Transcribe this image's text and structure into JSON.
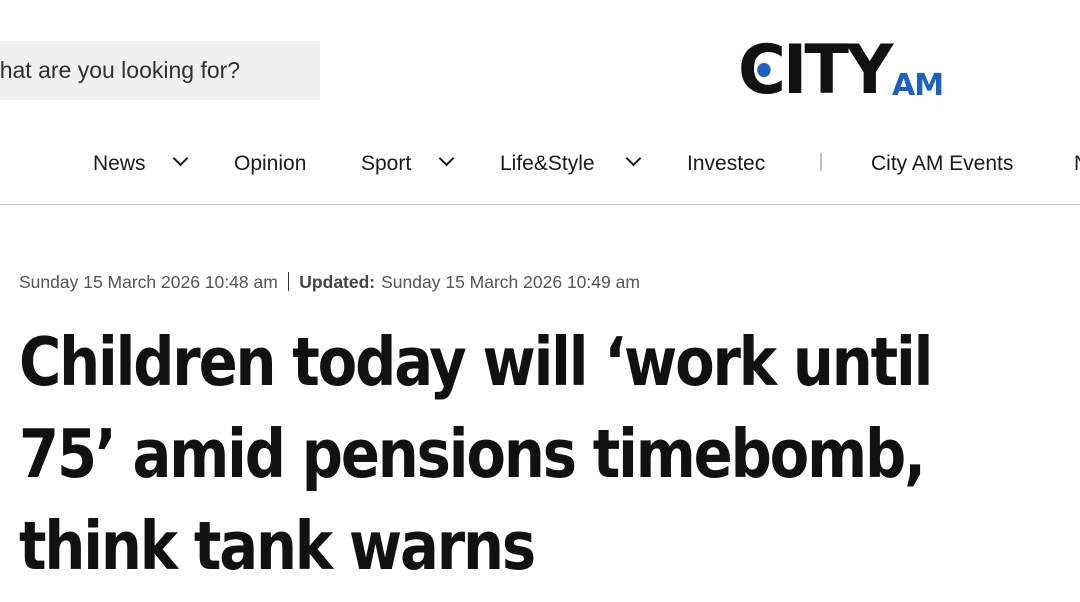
{
  "search": {
    "placeholder": "What are you looking for?"
  },
  "logo": {
    "main": "CITY",
    "sub": "AM"
  },
  "nav": {
    "items": [
      {
        "label": "News"
      },
      {
        "label": "Opinion"
      },
      {
        "label": "Sport"
      },
      {
        "label": "Life&Style"
      },
      {
        "label": "Investec"
      },
      {
        "label": "City AM Events"
      },
      {
        "label": "N"
      }
    ]
  },
  "article": {
    "published": "Sunday 15 March 2026 10:48 am",
    "updated_label": "Updated:",
    "updated": "Sunday 15 March 2026 10:49 am",
    "headline": "Children today will ‘work until 75’ amid pensions timebomb, think tank warns"
  },
  "colors": {
    "brand_blue": "#1f5fbf",
    "text": "#111111",
    "search_bg": "#f0f0f0"
  }
}
